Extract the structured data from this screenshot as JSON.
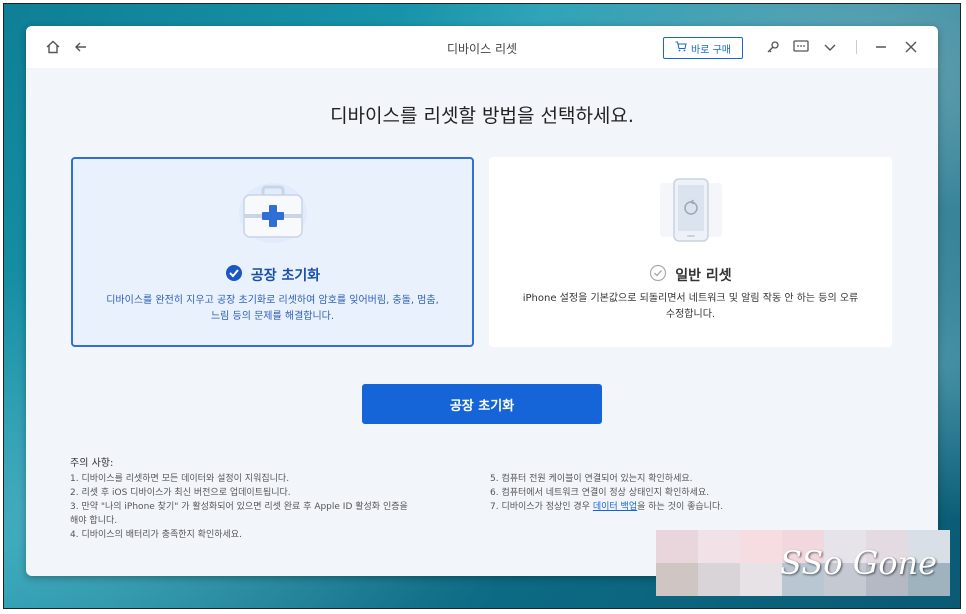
{
  "window": {
    "title": "디바이스 리셋"
  },
  "titlebar": {
    "buy_label": "바로 구매"
  },
  "heading": "디바이스를 리셋할 방법을 선택하세요.",
  "options": [
    {
      "title": "공장 초기화",
      "description": "디바이스를 완전히 지우고 공장 초기화로 리셋하여 암호를 잊어버림, 충돌, 멈춤, 느림 등의 문제를 해결합니다.",
      "selected": true
    },
    {
      "title": "일반 리셋",
      "description": "iPhone 설정을 기본값으로 되돌리면서 네트워크 및 알림 작동 안 하는 등의 오류 수정합니다.",
      "selected": false
    }
  ],
  "primary_button": "공장 초기화",
  "notes": {
    "title": "주의 사항:",
    "left": [
      "1. 디바이스를 리셋하면 모든 데이터와 설정이 지워집니다.",
      "2. 리셋 후 iOS 디바이스가 최신 버전으로 업데이트됩니다.",
      "3. 만약 \"나의 iPhone 찾기\" 가 활성화되어 있으면 리셋 완료 후 Apple ID 활성화 인증을",
      "해야 합니다.",
      "4. 디바이스의 배터리가 충족한지 확인하세요."
    ],
    "right": [
      "5. 컴퓨터 전원 케이블이 연결되어 있는지 확인하세요.",
      "6. 컴퓨터에서 네트워크 연결이 정상 상태인지 확인하세요."
    ],
    "right_item7_prefix": "7. 디바이스가 정상인 경우",
    "right_item7_link": "데이터 백업",
    "right_item7_suffix": "을 하는 것이 좋습니다."
  },
  "watermark": {
    "text": "SSo Gone"
  },
  "colors": {
    "accent": "#1565d8",
    "selected_bg": "#e9f1fd"
  }
}
